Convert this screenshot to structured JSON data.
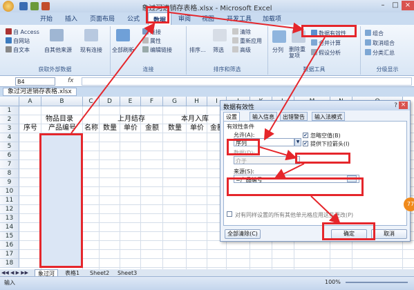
{
  "window": {
    "title": "象过河进销存表格.xlsx - Microsoft Excel"
  },
  "tabs": [
    "开始",
    "插入",
    "页面布局",
    "公式",
    "数据",
    "审阅",
    "视图",
    "开发工具",
    "加载项"
  ],
  "active_tab": "数据",
  "ribbon": {
    "g1": {
      "items": [
        "自 Access",
        "自网站",
        "自文本",
        "自其他来源",
        "现有连接"
      ],
      "label": "获取外部数据"
    },
    "g2": {
      "items": [
        "全部刷新",
        "连接",
        "属性",
        "编辑链接"
      ],
      "label": "连接"
    },
    "g3": {
      "items": [
        "排序...",
        "筛选",
        "清除",
        "重新应用",
        "高级"
      ],
      "label": "排序和筛选"
    },
    "g4": {
      "items": [
        "分列",
        "删除重复项",
        "数据有效性",
        "合并计算",
        "假设分析"
      ],
      "label": "数据工具"
    },
    "g5": {
      "items": [
        "组合",
        "取消组合",
        "分类汇总"
      ],
      "label": "分级显示"
    }
  },
  "namebox": "B4",
  "fx": "fx",
  "workbook_tab": "象过河进销存表格.xlsx",
  "columns": [
    "A",
    "B",
    "C",
    "D",
    "E",
    "F",
    "G",
    "H",
    "I",
    "J",
    "K",
    "L",
    "M",
    "N",
    "O"
  ],
  "rows": [
    "1",
    "2",
    "3",
    "4",
    "5",
    "6",
    "7",
    "8",
    "9",
    "10",
    "11",
    "12",
    "13",
    "14",
    "15",
    "16",
    "17",
    "18"
  ],
  "sheet": {
    "title": "象过河进销存表",
    "group1": "物品目录",
    "group2": "上月结存",
    "group3": "本月入库",
    "headers": [
      "序号",
      "产品编号",
      "名称",
      "数量",
      "单价",
      "金额",
      "数量",
      "单价",
      "金额"
    ]
  },
  "sheet_tabs": [
    "象过河",
    "表格1",
    "Sheet2",
    "Sheet3"
  ],
  "status": {
    "left": "输入",
    "zoom": "100%"
  },
  "dialog": {
    "title": "数据有效性",
    "tabs": [
      "设置",
      "输入信息",
      "出错警告",
      "输入法模式"
    ],
    "criteria_label": "有效性条件",
    "allow_label": "允许(A):",
    "allow_value": "序列",
    "ignore_blank": "忽略空值(B)",
    "dropdown": "提供下拉箭头(I)",
    "data_label": "数据(D):",
    "data_value": "介于",
    "source_label": "来源(S):",
    "source_value": "=产品编号",
    "apply_all": "对有同样设置的所有其他单元格应用这些更改(P)",
    "clear_all": "全部清除(C)",
    "ok": "确定",
    "cancel": "取消"
  },
  "badge": "77"
}
